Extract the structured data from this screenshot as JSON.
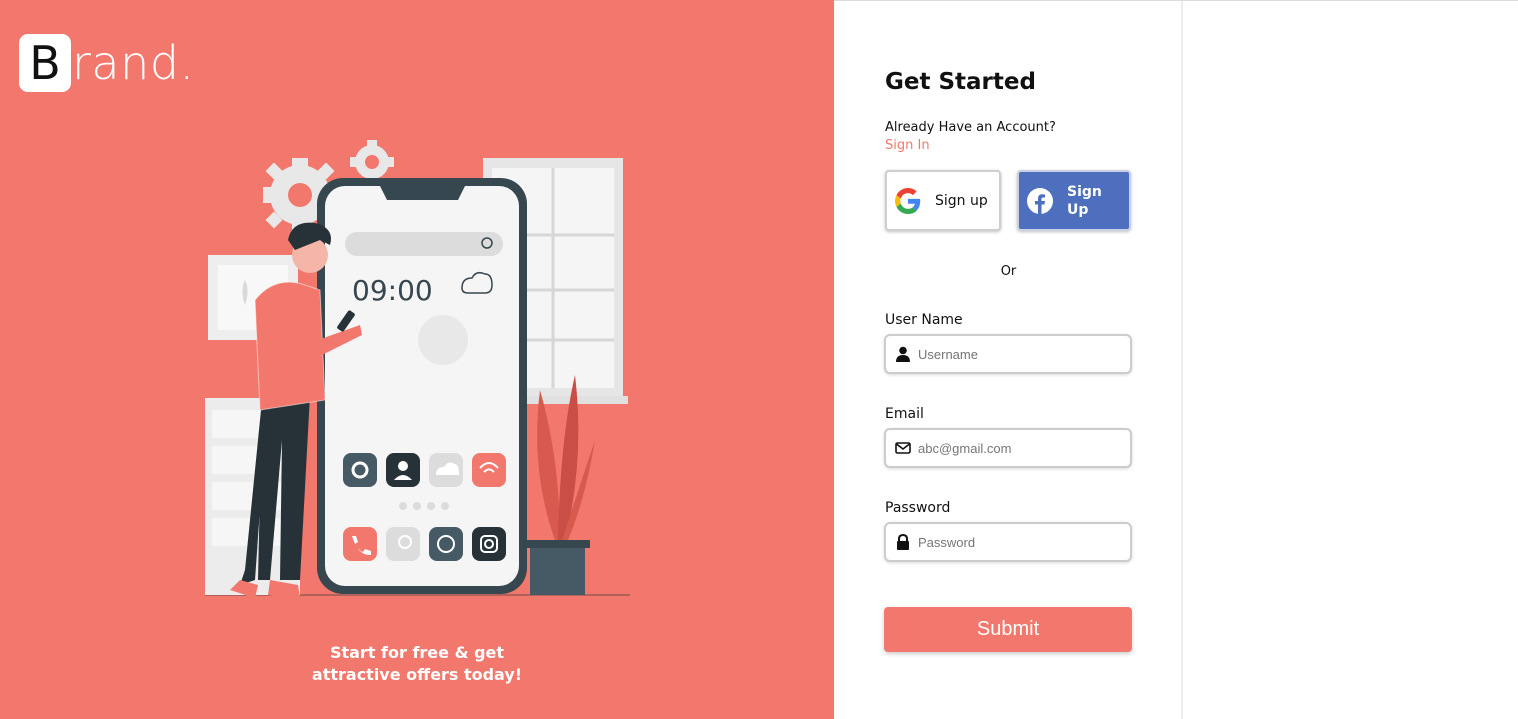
{
  "brand": {
    "initial": "B",
    "rest": "rand."
  },
  "tagline": {
    "line1": "Start for free & get",
    "line2": "attractive offers today!"
  },
  "phone": {
    "time": "09:00"
  },
  "form": {
    "title": "Get Started",
    "have_account": "Already Have an Account?",
    "signin": "Sign In",
    "google_label": "Sign up",
    "facebook_label": "Sign Up",
    "or": "Or",
    "username": {
      "label": "User Name",
      "placeholder": "Username",
      "value": ""
    },
    "email": {
      "label": "Email",
      "placeholder": "abc@gmail.com",
      "value": ""
    },
    "password": {
      "label": "Password",
      "placeholder": "Password",
      "value": ""
    },
    "submit": "Submit"
  },
  "colors": {
    "accent": "#f2786d",
    "facebook": "#4d6fbd",
    "dark": "#37474f"
  },
  "icons": [
    "google-icon",
    "facebook-icon",
    "user-icon",
    "envelope-icon",
    "lock-icon"
  ]
}
